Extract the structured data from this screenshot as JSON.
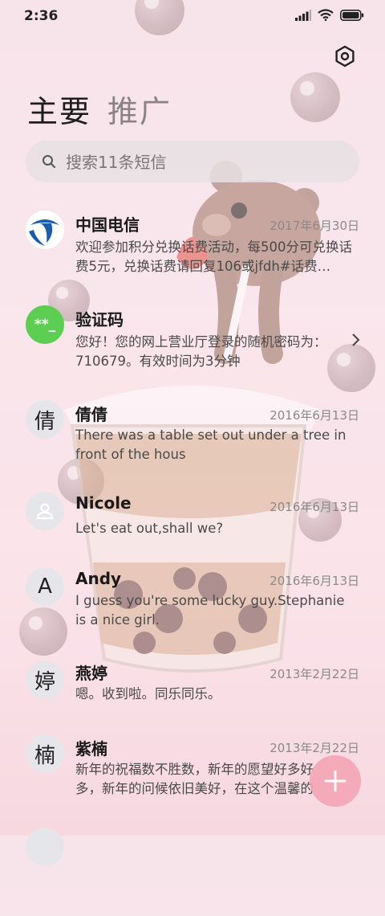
{
  "status": {
    "time": "2:36"
  },
  "tabs": [
    {
      "label": "主要"
    },
    {
      "label": "推广"
    }
  ],
  "search": {
    "placeholder": "搜索11条短信"
  },
  "conversations": [
    {
      "name": "中国电信",
      "date": "2017年6月30日",
      "preview": "欢迎参加积分兑换话费活动，每500分可兑换话费5元，兑换话费请回复106或jfdh#话费…",
      "avatar": "china-telecom-logo"
    },
    {
      "name": "验证码",
      "date": "",
      "preview": "您好！您的网上营业厅登录的随机密码为：710679。有效时间为3分钟",
      "avatar_text": "**_"
    },
    {
      "name": "倩倩",
      "date": "2016年6月13日",
      "preview": "There was a table set out under a tree in front of the hous",
      "avatar_text": "倩"
    },
    {
      "name": "Nicole",
      "date": "2016年6月13日",
      "preview": "Let's eat out,shall we?",
      "avatar": "person-icon"
    },
    {
      "name": "Andy",
      "date": "2016年6月13日",
      "preview": "I guess you're some lucky guy.Stephanie is a nice girl.",
      "avatar_text": "A"
    },
    {
      "name": "燕婷",
      "date": "2013年2月22日",
      "preview": "嗯。收到啦。同乐同乐。",
      "avatar_text": "婷"
    },
    {
      "name": "紫楠",
      "date": "2013年2月22日",
      "preview": "新年的祝福数不胜数，新年的愿望好多好多，新年的问候依旧美好，在这个温馨的时刻…",
      "avatar_text": "楠"
    }
  ],
  "colors": {
    "accent_green": "#5ccf52",
    "fab_pink": "#f4a5b4",
    "telecom_blue": "#1a5dab"
  }
}
